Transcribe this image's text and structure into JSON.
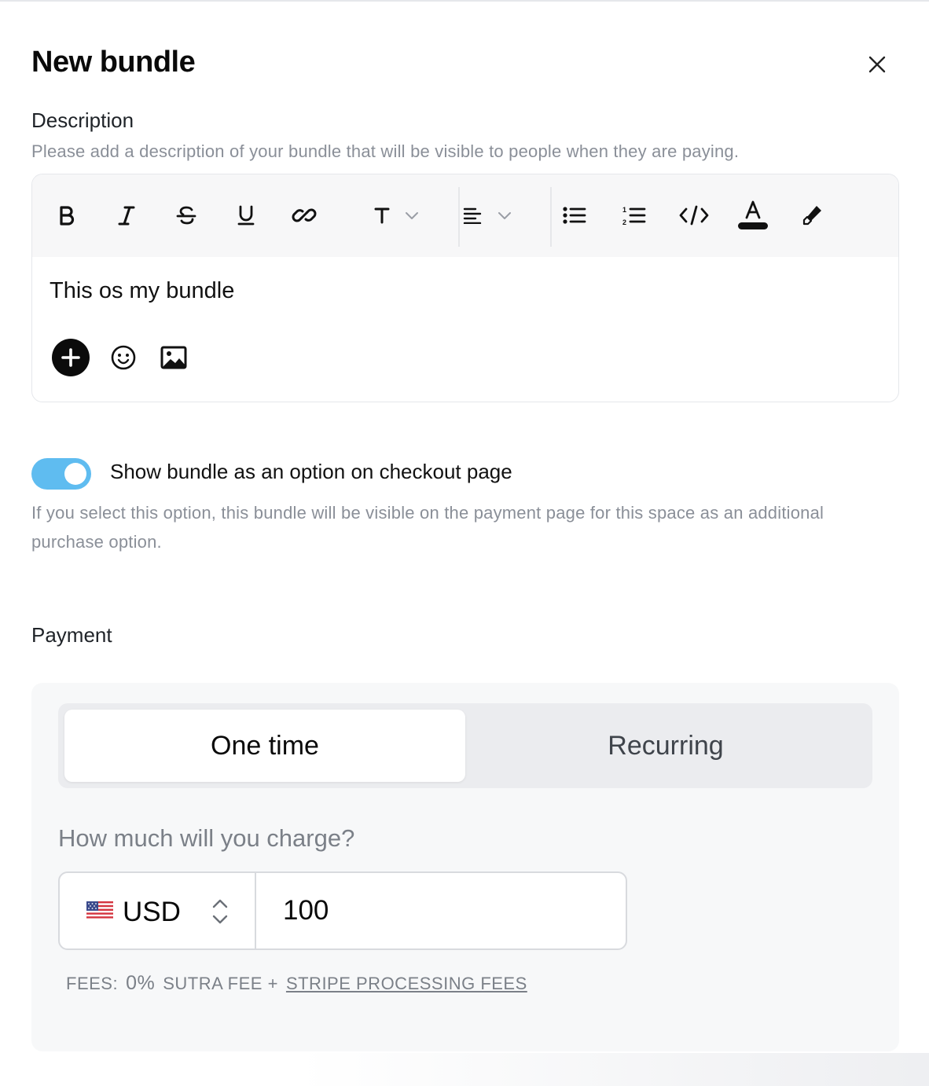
{
  "dialog": {
    "title": "New bundle",
    "close_icon": "close-icon"
  },
  "description": {
    "label": "Description",
    "hint": "Please add a description of your bundle that will be visible to people when they are paying.",
    "content": "This os my bundle",
    "toolbar": [
      "bold-icon",
      "italic-icon",
      "strikethrough-icon",
      "underline-icon",
      "link-icon",
      "text-style-icon",
      "align-icon",
      "bullet-list-icon",
      "numbered-list-icon",
      "code-icon",
      "text-color-icon",
      "highlight-icon"
    ],
    "actions": [
      "add-icon",
      "emoji-icon",
      "image-icon"
    ]
  },
  "checkout_option": {
    "enabled": true,
    "label": "Show bundle as an option on checkout page",
    "hint": "If you select this option, this bundle will be visible on the payment page for this space as an additional purchase option."
  },
  "payment": {
    "label": "Payment",
    "tabs": [
      {
        "label": "One time",
        "selected": true
      },
      {
        "label": "Recurring",
        "selected": false
      }
    ],
    "question": "How much will you charge?",
    "currency": "USD",
    "amount": "100",
    "fees": {
      "prefix": "FEES:",
      "percent": "0%",
      "middle": "SUTRA FEE +",
      "link": "STRIPE PROCESSING FEES"
    }
  },
  "colors": {
    "toggle_on": "#5fbcf0",
    "panel_bg": "#f7f8f9",
    "muted_text": "#8a8f98"
  }
}
